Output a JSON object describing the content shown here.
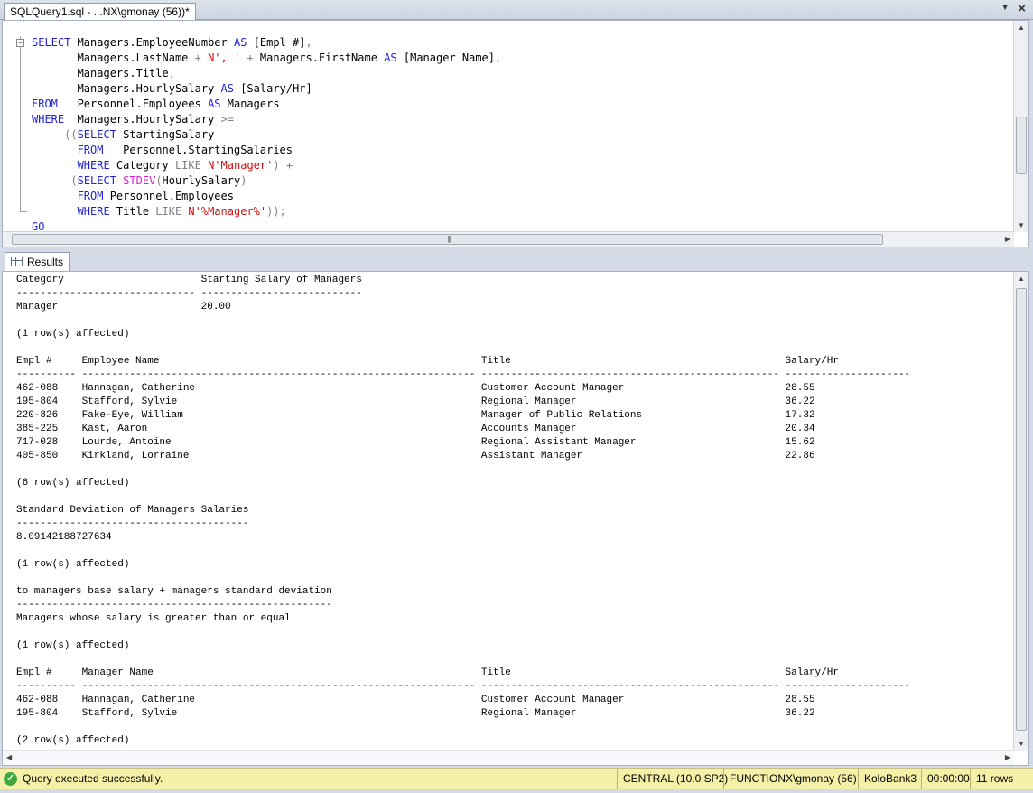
{
  "editor_tab": {
    "title": "SQLQuery1.sql - ...NX\\gmonay (56))*",
    "dropdown_icon": "chevron-down-icon",
    "close_icon": "close-icon"
  },
  "query_lines": [
    [
      {
        "t": "SELECT ",
        "c": "kw"
      },
      {
        "t": "Managers.EmployeeNumber "
      },
      {
        "t": "AS",
        "c": "kw"
      },
      {
        "t": " [Empl #]"
      },
      {
        "t": ",",
        "c": "op"
      }
    ],
    [
      {
        "t": "       Managers.LastName "
      },
      {
        "t": "+",
        "c": "op"
      },
      {
        "t": " "
      },
      {
        "t": "N', '",
        "c": "str"
      },
      {
        "t": " "
      },
      {
        "t": "+",
        "c": "op"
      },
      {
        "t": " Managers.FirstName "
      },
      {
        "t": "AS",
        "c": "kw"
      },
      {
        "t": " [Manager Name]"
      },
      {
        "t": ",",
        "c": "op"
      }
    ],
    [
      {
        "t": "       Managers.Title"
      },
      {
        "t": ",",
        "c": "op"
      }
    ],
    [
      {
        "t": "       Managers.HourlySalary "
      },
      {
        "t": "AS",
        "c": "kw"
      },
      {
        "t": " [Salary/Hr]"
      }
    ],
    [
      {
        "t": "FROM",
        "c": "kw"
      },
      {
        "t": "   Personnel.Employees "
      },
      {
        "t": "AS",
        "c": "kw"
      },
      {
        "t": " Managers"
      }
    ],
    [
      {
        "t": "WHERE",
        "c": "kw"
      },
      {
        "t": "  Managers.HourlySalary "
      },
      {
        "t": ">=",
        "c": "op"
      }
    ],
    [
      {
        "t": "     "
      },
      {
        "t": "((",
        "c": "op"
      },
      {
        "t": "SELECT",
        "c": "kw"
      },
      {
        "t": " StartingSalary"
      }
    ],
    [
      {
        "t": "       "
      },
      {
        "t": "FROM",
        "c": "kw"
      },
      {
        "t": "   Personnel.StartingSalaries"
      }
    ],
    [
      {
        "t": "       "
      },
      {
        "t": "WHERE",
        "c": "kw"
      },
      {
        "t": " Category "
      },
      {
        "t": "LIKE",
        "c": "op"
      },
      {
        "t": " "
      },
      {
        "t": "N'Manager'",
        "c": "str"
      },
      {
        "t": ")",
        "c": "op"
      },
      {
        "t": " "
      },
      {
        "t": "+",
        "c": "op"
      }
    ],
    [
      {
        "t": "      "
      },
      {
        "t": "(",
        "c": "op"
      },
      {
        "t": "SELECT",
        "c": "kw"
      },
      {
        "t": " "
      },
      {
        "t": "STDEV",
        "c": "fn"
      },
      {
        "t": "(",
        "c": "op"
      },
      {
        "t": "HourlySalary"
      },
      {
        "t": ")",
        "c": "op"
      }
    ],
    [
      {
        "t": "       "
      },
      {
        "t": "FROM",
        "c": "kw"
      },
      {
        "t": " Personnel.Employees"
      }
    ],
    [
      {
        "t": "       "
      },
      {
        "t": "WHERE",
        "c": "kw"
      },
      {
        "t": " Title "
      },
      {
        "t": "LIKE",
        "c": "op"
      },
      {
        "t": " "
      },
      {
        "t": "N'%Manager%'",
        "c": "str"
      },
      {
        "t": "));",
        "c": "op"
      }
    ],
    [
      {
        "t": "GO",
        "c": "kw"
      }
    ]
  ],
  "results_tab": {
    "label": "Results",
    "icon": "results-grid-icon"
  },
  "results_lines": [
    "Category                       Starting Salary of Managers",
    "------------------------------ ---------------------------",
    "Manager                        20.00",
    "",
    "(1 row(s) affected)",
    "",
    "Empl #     Employee Name                                                      Title                                              Salary/Hr",
    "---------- ------------------------------------------------------------------ -------------------------------------------------- ---------------------",
    "462-088    Hannagan, Catherine                                                Customer Account Manager                           28.55",
    "195-804    Stafford, Sylvie                                                   Regional Manager                                   36.22",
    "220-826    Fake-Eye, William                                                  Manager of Public Relations                        17.32",
    "385-225    Kast, Aaron                                                        Accounts Manager                                   20.34",
    "717-028    Lourde, Antoine                                                    Regional Assistant Manager                         15.62",
    "405-850    Kirkland, Lorraine                                                 Assistant Manager                                  22.86",
    "",
    "(6 row(s) affected)",
    "",
    "Standard Deviation of Managers Salaries",
    "---------------------------------------",
    "8.09142188727634",
    "",
    "(1 row(s) affected)",
    "",
    "to managers base salary + managers standard deviation",
    "-----------------------------------------------------",
    "Managers whose salary is greater than or equal",
    "",
    "(1 row(s) affected)",
    "",
    "Empl #     Manager Name                                                       Title                                              Salary/Hr",
    "---------- ------------------------------------------------------------------ -------------------------------------------------- ---------------------",
    "462-088    Hannagan, Catherine                                                Customer Account Manager                           28.55",
    "195-804    Stafford, Sylvie                                                   Regional Manager                                   36.22",
    "",
    "(2 row(s) affected)"
  ],
  "status": {
    "icon": "check-icon",
    "message": "Query executed successfully.",
    "server": "CENTRAL (10.0 SP2)",
    "login": "FUNCTIONX\\gmonay (56)",
    "database": "KoloBank3",
    "elapsed": "00:00:00",
    "rows": "11 rows"
  }
}
